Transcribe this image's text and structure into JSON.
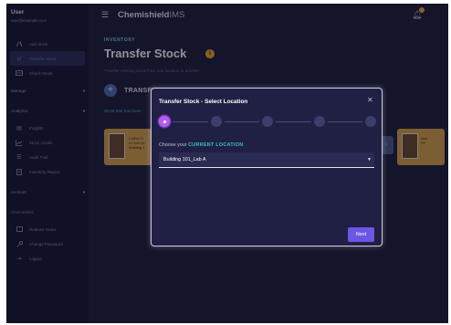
{
  "sidebar": {
    "user_name": "User",
    "user_email": "user@example.com",
    "top_items": [
      {
        "label": "Add Stock",
        "icon": "flask-icon"
      },
      {
        "label": "Transfer Stock",
        "icon": "swap-icon"
      },
      {
        "label": "Check Stock",
        "icon": "table-icon"
      }
    ],
    "manage_label": "Manage",
    "analytics_label": "Analytics",
    "analytics_items": [
      {
        "label": "Insights",
        "icon": "insights-icon"
      },
      {
        "label": "Stock Levels",
        "icon": "chart-icon"
      },
      {
        "label": "Audit Trail",
        "icon": "list-icon"
      },
      {
        "label": "Inventory Report",
        "icon": "report-icon"
      }
    ],
    "account_label": "Account",
    "chemishield_label": "ChemiShield",
    "account_items": [
      {
        "label": "Release Notes",
        "icon": "notes-icon"
      },
      {
        "label": "Change Password",
        "icon": "key-icon"
      },
      {
        "label": "Logout",
        "icon": "logout-icon"
      }
    ]
  },
  "topbar": {
    "brand_main": "Chemishield",
    "brand_suffix": "IMS"
  },
  "page": {
    "breadcrumb": "INVENTORY",
    "title": "Transfer Stock",
    "subtitle": "Transfer existing stock from one location to another",
    "transfer_label": "TRANSFER STOCK",
    "stock_hint": "Stock that has been",
    "card_left_text": [
      "Coffee Fi",
      "5 Fluid ml",
      "Building 1"
    ],
    "card_right_text": [
      "Nex",
      "Fe"
    ]
  },
  "modal": {
    "title": "Transfer Stock - Select Location",
    "step_count": 5,
    "active_step": 1,
    "location_prompt": "Choose your",
    "location_prompt_highlight": "CURRENT LOCATION",
    "selected_location": "Building 101_Lab A",
    "next_label": "Next"
  },
  "colors": {
    "accent": "#6a58e4",
    "step_active": "#b45df0",
    "highlight": "#3fc0c4",
    "badge": "#f0a81f"
  }
}
